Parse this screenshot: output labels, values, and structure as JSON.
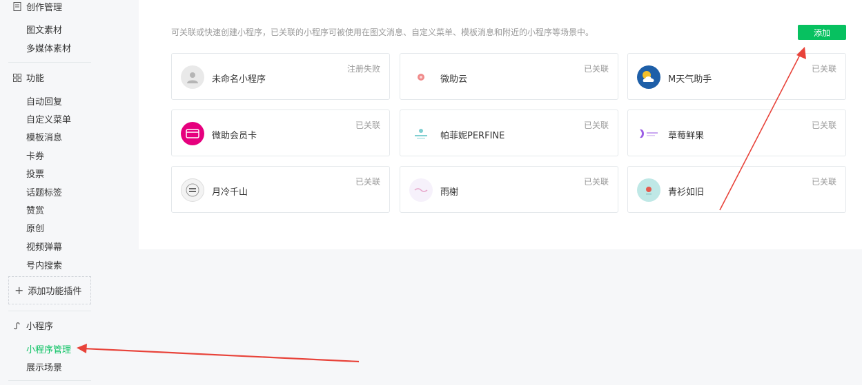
{
  "sidebar": {
    "creation": {
      "title": "创作管理",
      "items": [
        "图文素材",
        "多媒体素材"
      ]
    },
    "features": {
      "title": "功能",
      "items": [
        "自动回复",
        "自定义菜单",
        "模板消息",
        "卡券",
        "投票",
        "话题标签",
        "赞赏",
        "原创",
        "视频弹幕",
        "号内搜索"
      ]
    },
    "add_plugin": "添加功能插件",
    "miniprogram": {
      "title": "小程序",
      "items": [
        "小程序管理",
        "展示场景"
      ]
    }
  },
  "main": {
    "intro": "可关联或快速创建小程序，已关联的小程序可被使用在图文消息、自定义菜单、模板消息和附近的小程序等场景中。",
    "add_button": "添加",
    "cards": [
      {
        "name": "未命名小程序",
        "status": "注册失败",
        "icon": "default-user-avatar"
      },
      {
        "name": "微助云",
        "status": "已关联",
        "icon": "flower-logo"
      },
      {
        "name": "M天气助手",
        "status": "已关联",
        "icon": "weather-logo"
      },
      {
        "name": "微助会员卡",
        "status": "已关联",
        "icon": "member-card-logo"
      },
      {
        "name": "帕菲妮PERFINE",
        "status": "已关联",
        "icon": "perfine-logo"
      },
      {
        "name": "草莓鲜果",
        "status": "已关联",
        "icon": "strawberry-logo"
      },
      {
        "name": "月冷千山",
        "status": "已关联",
        "icon": "moon-logo"
      },
      {
        "name": "雨榭",
        "status": "已关联",
        "icon": "yuxie-logo"
      },
      {
        "name": "青衫如旧",
        "status": "已关联",
        "icon": "qingshan-logo"
      }
    ]
  },
  "colors": {
    "accent": "#07c160",
    "annotation_arrow": "#e8433a"
  }
}
